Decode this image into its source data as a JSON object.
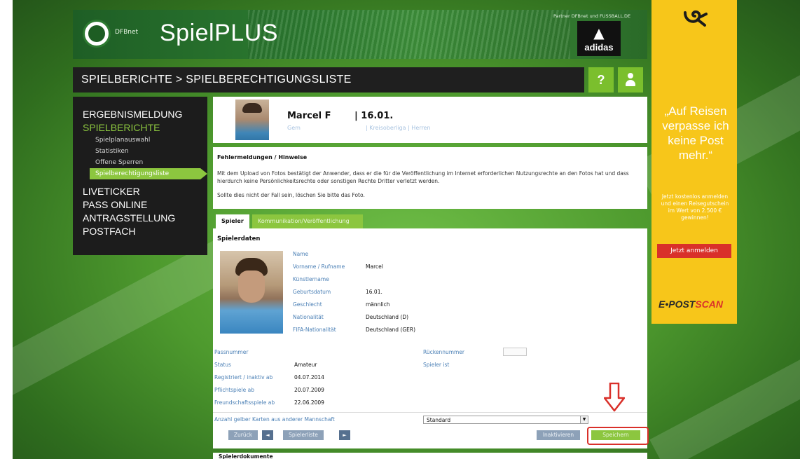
{
  "header": {
    "brand_badge": "DFBnet",
    "brand": "SpielPLUS",
    "partner": "Partner DFBnet und FUSSBALL.DE",
    "sponsor": "adidas"
  },
  "titlebar": {
    "title": "SPIELBERICHTE > SPIELBERECHTIGUNGSLISTE",
    "help_label": "?"
  },
  "sidebar": {
    "items": [
      {
        "label": "ERGEBNISMELDUNG"
      },
      {
        "label": "SPIELBERICHTE"
      },
      {
        "label": "Spielplanauswahl"
      },
      {
        "label": "Statistiken"
      },
      {
        "label": "Offene Sperren"
      },
      {
        "label": "Spielberechtigungsliste"
      },
      {
        "label": "LIVETICKER"
      },
      {
        "label": "PASS ONLINE"
      },
      {
        "label": "ANTRAGSTELLUNG"
      },
      {
        "label": "POSTFACH"
      }
    ]
  },
  "profile": {
    "name": "Marcel F",
    "date": "| 16.01.",
    "club": "Gem",
    "league": "| Kreisoberliga | Herren"
  },
  "notice": {
    "title": "Fehlermeldungen / Hinweise",
    "text": "Mit dem Upload von Fotos bestätigt der Anwender, dass er die für die Veröffentlichung im Internet erforderlichen Nutzungsrechte an den Fotos hat und dass hierdurch keine Persönlichkeitsrechte oder sonstigen Rechte Dritter verletzt werden.",
    "text2": "Sollte dies nicht der Fall sein, löschen Sie bitte das Foto."
  },
  "tabs": {
    "spieler": "Spieler",
    "kommunikation": "Kommunikation/Veröffentlichung"
  },
  "details": {
    "title": "Spielerdaten",
    "labels": {
      "name": "Name",
      "vorname": "Vorname / Rufname",
      "kuenstlername": "Künstlername",
      "geburtsdatum": "Geburtsdatum",
      "geschlecht": "Geschlecht",
      "nationalitaet": "Nationalität",
      "fifa": "FIFA-Nationalität"
    },
    "values": {
      "vorname": "Marcel",
      "geburtsdatum": "16.01.",
      "geschlecht": "männlich",
      "nationalitaet": "Deutschland (D)",
      "fifa": "Deutschland (GER)"
    },
    "lower": {
      "passnummer_label": "Passnummer",
      "status_label": "Status",
      "status_value": "Amateur",
      "registriert_label": "Registriert / inaktiv ab",
      "registriert_value": "04.07.2014",
      "pflicht_label": "Pflichtspiele ab",
      "pflicht_value": "20.07.2009",
      "freund_label": "Freundschaftsspiele ab",
      "freund_value": "22.06.2009",
      "rueck_label": "Rückennummer",
      "spieler_ist_label": "Spieler ist"
    },
    "cards_label": "Anzahl gelber Karten aus anderer Mannschaft",
    "cards_value": "Standard"
  },
  "buttons": {
    "zurueck": "Zurück",
    "prev": "◄",
    "list": "Spielerliste",
    "next": "►",
    "inaktiv": "Inaktivieren",
    "speichern": "Speichern"
  },
  "bottom": {
    "title": "Spielerdokumente"
  },
  "ad": {
    "quote": "„Auf Reisen verpasse ich keine Post mehr.“",
    "small": "Jetzt kostenlos anmelden und einen Reisegutschein im Wert von 2.500 € gewinnen!",
    "button": "Jetzt anmelden",
    "brand_a": "E•POST",
    "brand_b": "SCAN"
  },
  "colors": {
    "accent_green": "#8cc63f",
    "ad_yellow": "#f7c61a",
    "highlight_red": "#d9302a"
  }
}
